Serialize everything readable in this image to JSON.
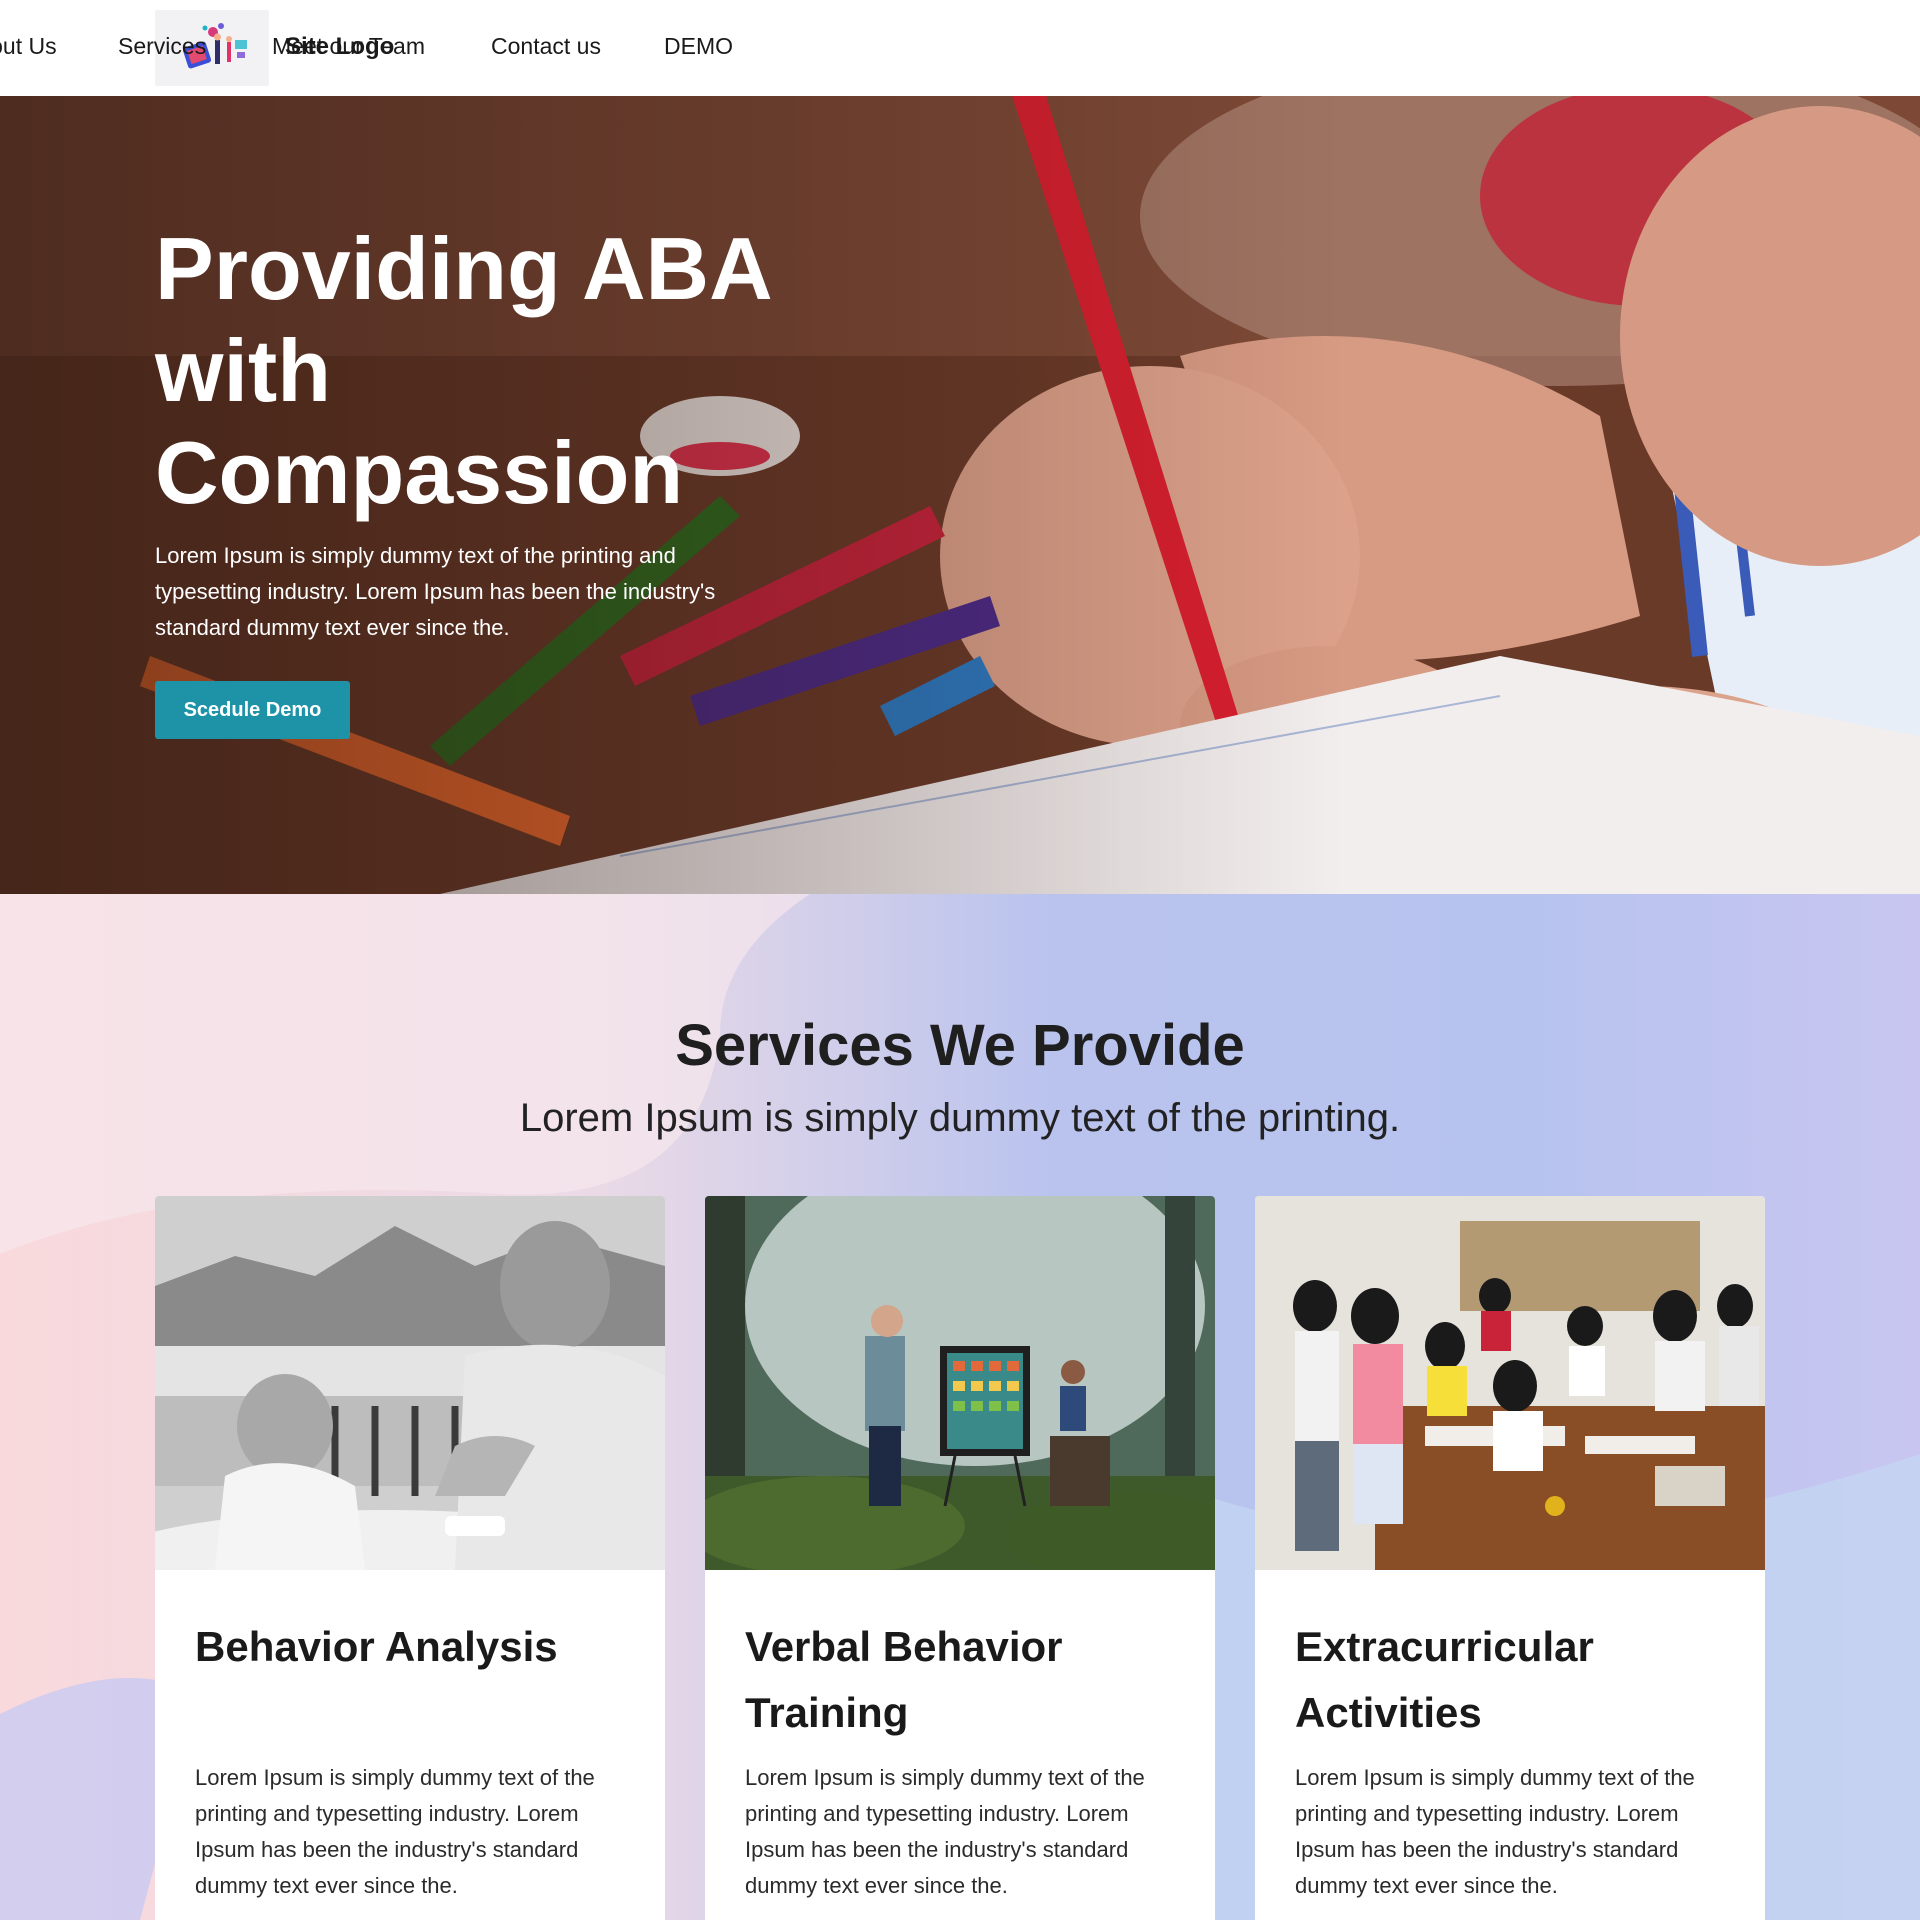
{
  "header": {
    "logo_text": "Site Logo",
    "nav": [
      "About Us",
      "Services",
      "Meet our Team",
      "Contact us",
      "DEMO"
    ]
  },
  "hero": {
    "title": "Providing ABA with Compassion",
    "text": "Lorem Ipsum is simply dummy text of the printing and typesetting industry. Lorem Ipsum has been the industry's standard dummy text ever since the.",
    "button": "Scedule Demo",
    "button_color": "#1e93a8"
  },
  "services": {
    "title": "Services We Provide",
    "subtitle": "Lorem Ipsum is simply dummy text of the printing.",
    "cards": [
      {
        "title": "Behavior Analysis",
        "text": "Lorem Ipsum is simply dummy text of the printing and typesetting industry. Lorem Ipsum has been the industry's standard dummy text ever since the."
      },
      {
        "title": "Verbal Behavior Training",
        "text": "Lorem Ipsum is simply dummy text of the printing and typesetting industry. Lorem Ipsum has been the industry's standard dummy text ever since the."
      },
      {
        "title": "Extracurricular Activities",
        "text": "Lorem Ipsum is simply dummy text of the printing and typesetting industry. Lorem Ipsum has been the industry's standard dummy text ever since the."
      }
    ]
  }
}
